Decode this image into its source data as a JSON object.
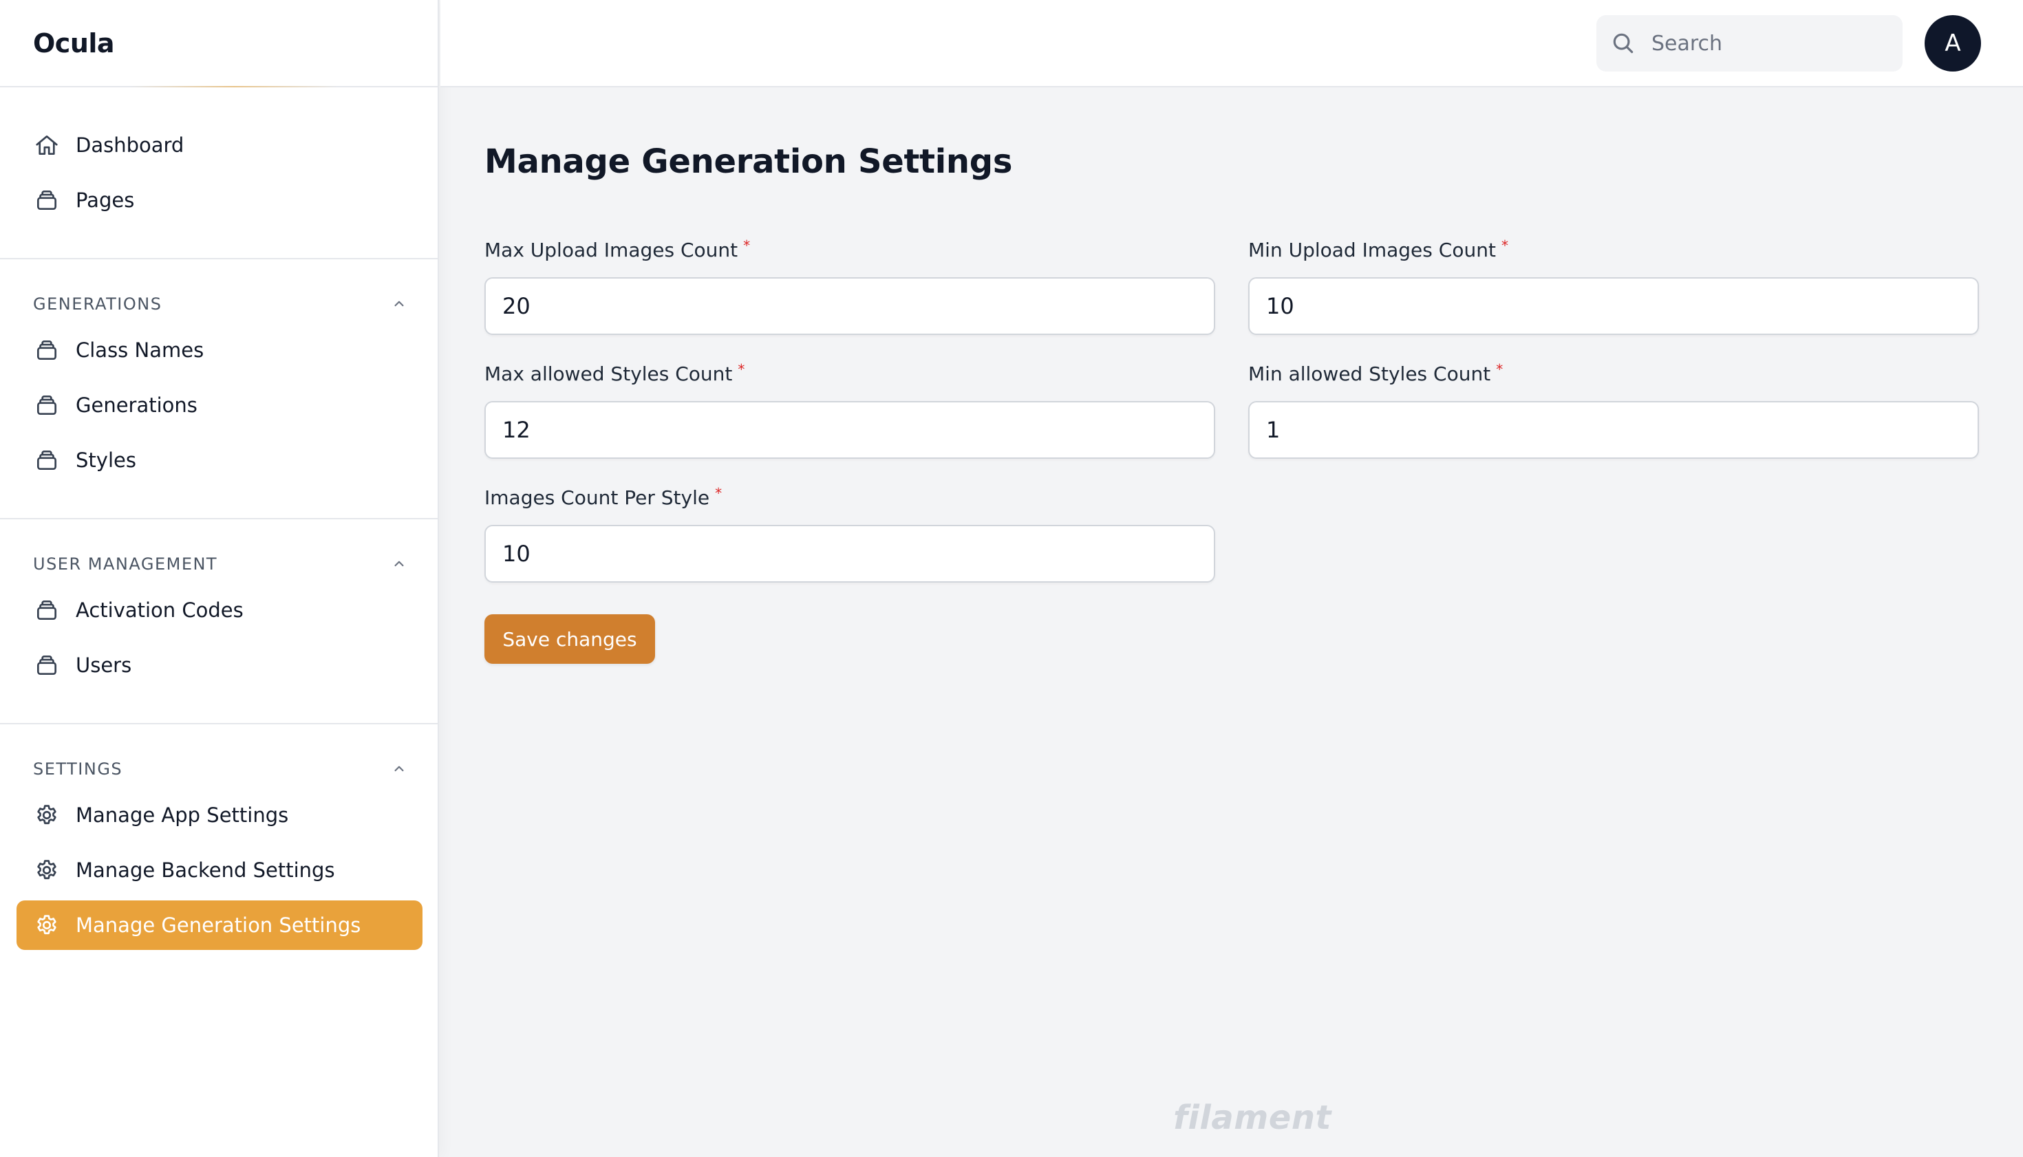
{
  "app": {
    "brand": "Ocula",
    "footer_logo": "filament"
  },
  "colors": {
    "accent": "#e9a23b",
    "button": "#d07f2e",
    "avatar": "#0f172a",
    "required": "#dc2626"
  },
  "sidebar": {
    "top_items": [
      {
        "label": "Dashboard",
        "icon": "home-icon"
      },
      {
        "label": "Pages",
        "icon": "stack-icon"
      }
    ],
    "groups": [
      {
        "title": "GENERATIONS",
        "items": [
          {
            "label": "Class Names",
            "icon": "stack-icon"
          },
          {
            "label": "Generations",
            "icon": "stack-icon"
          },
          {
            "label": "Styles",
            "icon": "stack-icon"
          }
        ]
      },
      {
        "title": "USER MANAGEMENT",
        "items": [
          {
            "label": "Activation Codes",
            "icon": "stack-icon"
          },
          {
            "label": "Users",
            "icon": "stack-icon"
          }
        ]
      },
      {
        "title": "SETTINGS",
        "items": [
          {
            "label": "Manage App Settings",
            "icon": "gear-icon"
          },
          {
            "label": "Manage Backend Settings",
            "icon": "gear-icon"
          },
          {
            "label": "Manage Generation Settings",
            "icon": "gear-icon",
            "active": true
          }
        ]
      }
    ]
  },
  "topbar": {
    "search": {
      "placeholder": "Search",
      "value": ""
    },
    "avatar_initial": "A"
  },
  "main": {
    "title": "Manage Generation Settings",
    "fields": [
      {
        "label": "Max Upload Images Count",
        "value": "20",
        "required": "*"
      },
      {
        "label": "Min Upload Images Count",
        "value": "10",
        "required": "*"
      },
      {
        "label": "Max allowed Styles Count",
        "value": "12",
        "required": "*"
      },
      {
        "label": "Min allowed Styles Count",
        "value": "1",
        "required": "*"
      },
      {
        "label": "Images Count Per Style",
        "value": "10",
        "required": "*"
      }
    ],
    "save_label": "Save changes"
  }
}
